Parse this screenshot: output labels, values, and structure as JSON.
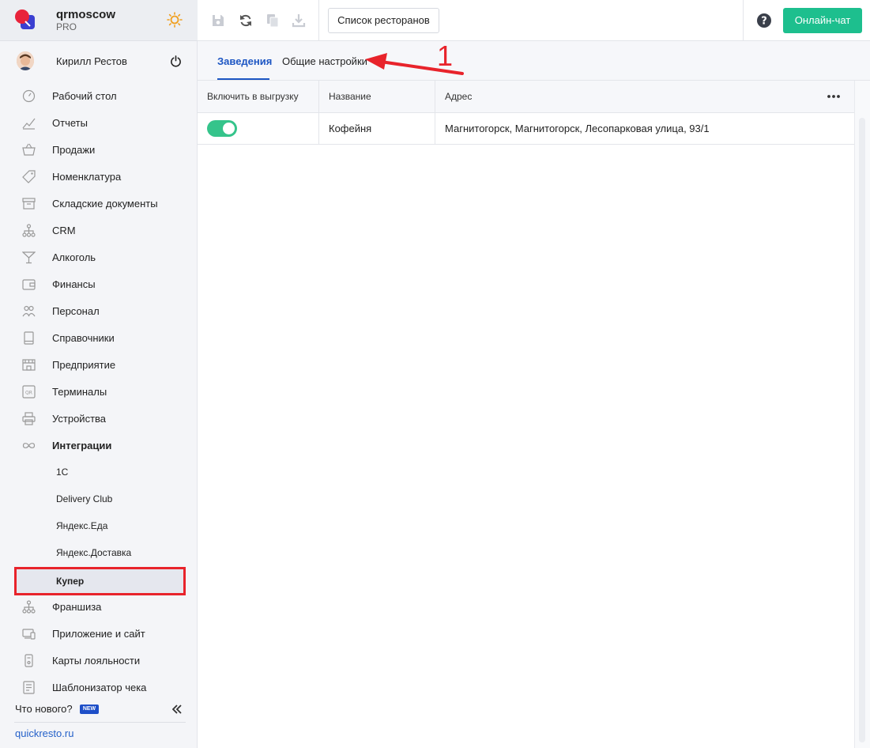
{
  "brand": {
    "name": "qrmoscow",
    "plan": "PRO"
  },
  "user": {
    "name": "Кирилл Рестов"
  },
  "nav": [
    {
      "label": "Рабочий стол",
      "icon": "dashboard-icon"
    },
    {
      "label": "Отчеты",
      "icon": "chart-icon"
    },
    {
      "label": "Продажи",
      "icon": "basket-icon"
    },
    {
      "label": "Номенклатура",
      "icon": "tag-icon"
    },
    {
      "label": "Складские документы",
      "icon": "archive-icon"
    },
    {
      "label": "CRM",
      "icon": "hierarchy-icon"
    },
    {
      "label": "Алкоголь",
      "icon": "cocktail-icon"
    },
    {
      "label": "Финансы",
      "icon": "wallet-icon"
    },
    {
      "label": "Персонал",
      "icon": "people-icon"
    },
    {
      "label": "Справочники",
      "icon": "book-icon"
    },
    {
      "label": "Предприятие",
      "icon": "store-icon"
    },
    {
      "label": "Терминалы",
      "icon": "qr-icon"
    },
    {
      "label": "Устройства",
      "icon": "printer-icon"
    },
    {
      "label": "Интеграции",
      "icon": "infinity-icon"
    }
  ],
  "integrations_sub": [
    "1С",
    "Delivery Club",
    "Яндекс.Еда",
    "Яндекс.Доставка"
  ],
  "active_sub": "Купер",
  "nav_after": [
    {
      "label": "Франшиза",
      "icon": "hierarchy-icon"
    },
    {
      "label": "Приложение и сайт",
      "icon": "devices-icon"
    },
    {
      "label": "Карты лояльности",
      "icon": "card-icon"
    },
    {
      "label": "Шаблонизатор чека",
      "icon": "receipt-icon"
    }
  ],
  "footer": {
    "whats_new": "Что нового?",
    "new_badge": "NEW",
    "site": "quickresto.ru"
  },
  "toolbar": {
    "restaurants_label": "Список ресторанов",
    "chat_label": "Онлайн-чат"
  },
  "tabs": [
    {
      "label": "Заведения",
      "active": true
    },
    {
      "label": "Общие настройки",
      "active": false
    }
  ],
  "annotation": {
    "number": "1"
  },
  "table": {
    "columns": [
      "Включить в выгрузку",
      "Название",
      "Адрес"
    ],
    "rows": [
      {
        "enabled": true,
        "name": "Кофейня",
        "address": "Магнитогорск, Магнитогорск, Лесопарковая улица, 93/1"
      }
    ]
  },
  "colors": {
    "accent": "#1d56c3",
    "chat": "#1dbf8e",
    "toggle": "#35c48b",
    "highlight": "#e8232b"
  }
}
